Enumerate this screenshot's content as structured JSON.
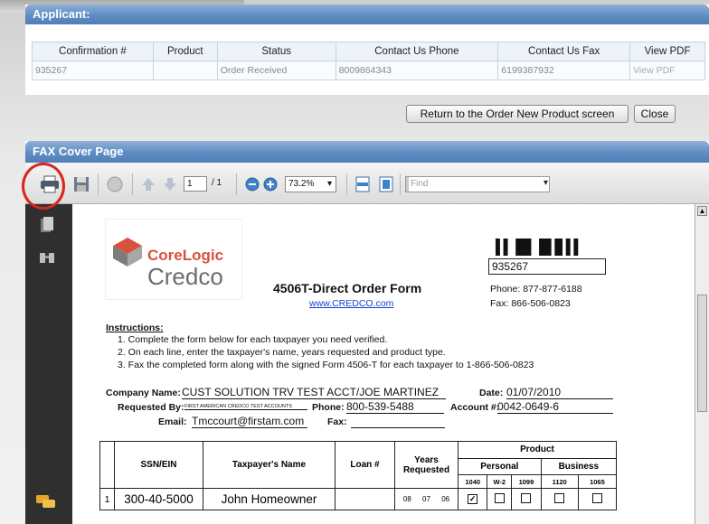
{
  "applicant": {
    "header": "Applicant:",
    "columns": [
      "Confirmation #",
      "Product",
      "Status",
      "Contact Us Phone",
      "Contact Us Fax",
      "View PDF"
    ],
    "row": [
      "935267",
      "",
      "Order Received",
      "8009864343",
      "6199387932",
      "View PDF"
    ]
  },
  "buttons": {
    "return_label": "Return to the Order New Product screen",
    "close_label": "Close"
  },
  "fax": {
    "header": "FAX Cover Page"
  },
  "toolbar": {
    "page_current": "1",
    "page_total": "/ 1",
    "zoom": "73.2%",
    "find_placeholder": "Find"
  },
  "doc": {
    "logo_core": "CoreLogic",
    "logo_credco": "Credco",
    "barcode_text": "▌▌▐█▌▐█▐▌▌▌",
    "conf_box": "935267",
    "title": "4506T-Direct Order Form",
    "url": "www.CREDCO.com",
    "phone": "Phone: 877-877-6188",
    "fax": "Fax: 866-506-0823",
    "instructions_label": "Instructions:",
    "instructions": [
      "1.  Complete the form below for each taxpayer you need verified.",
      "2.  On each line, enter the taxpayer's name, years requested and product type.",
      "3.  Fax the completed form along with the signed Form 4506-T for each taxpayer to 1-866-506-0823"
    ],
    "company_label": "Company Name:",
    "company_value": "CUST SOLUTION TRV TEST ACCT/JOE MARTINEZ",
    "date_label": "Date:",
    "date_value": "01/07/2010",
    "requested_label": "Requested By:",
    "requested_value": "FIRST AMERICAN CREDCO TEST ACCOUNTS",
    "phone_label": "Phone:",
    "phone_value": "800-539-5488",
    "account_label": "Account #:",
    "account_value": "0042-0649-6",
    "email_label": "Email:",
    "email_value": "Tmccourt@firstam.com",
    "fax_label": "Fax:",
    "table": {
      "h_ssn": "SSN/EIN",
      "h_name": "Taxpayer's Name",
      "h_loan": "Loan #",
      "h_years": "Years Requested",
      "h_product": "Product",
      "h_personal": "Personal",
      "h_business": "Business",
      "forms": [
        "1040",
        "W-2",
        "1099",
        "1120",
        "1065"
      ],
      "row_num": "1",
      "row_ssn": "300-40-5000",
      "row_name": "John Homeowner",
      "row_years": [
        "08",
        "07",
        "06"
      ]
    }
  }
}
